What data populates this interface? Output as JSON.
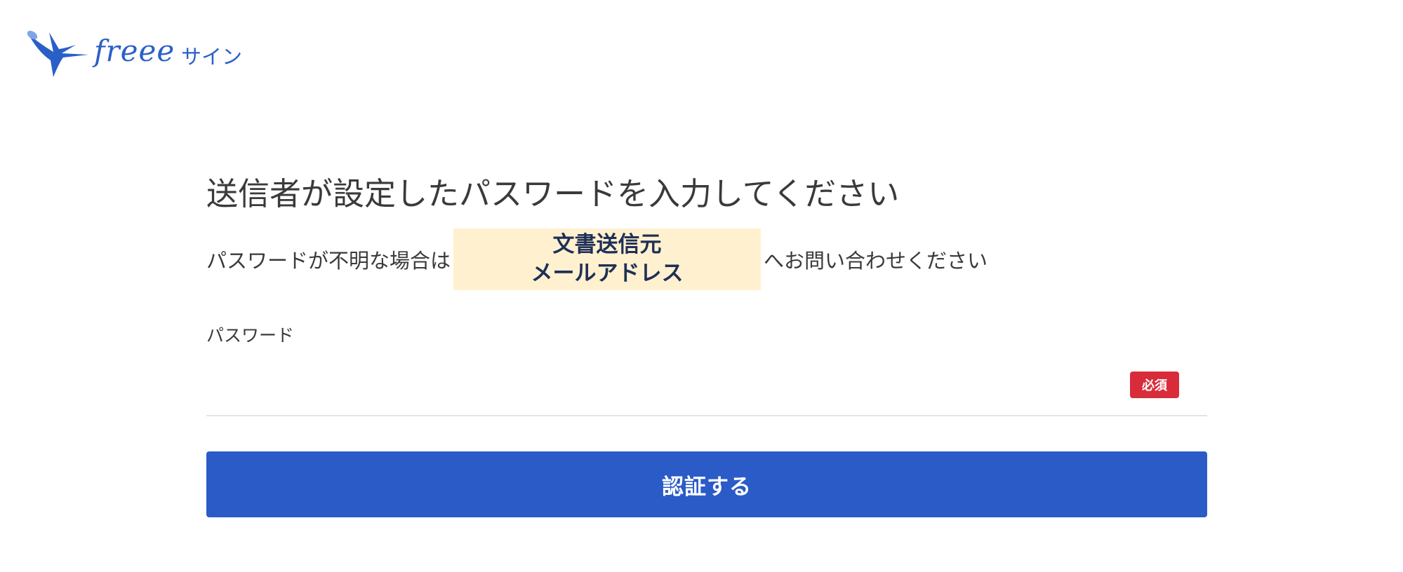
{
  "brand": {
    "logo_text": "freee",
    "logo_sub": "サイン",
    "color": "#2b5fc8"
  },
  "page": {
    "title": "送信者が設定したパスワードを入力してください",
    "notice_prefix": "パスワードが不明な場合は",
    "notice_highlight_line1": "文書送信元",
    "notice_highlight_line2": "メールアドレス",
    "notice_suffix": "へお問い合わせください"
  },
  "form": {
    "password_label": "パスワード",
    "password_value": "",
    "required_badge": "必須",
    "submit_label": "認証する"
  },
  "colors": {
    "button": "#2a5bc7",
    "required": "#d92c3a",
    "highlight": "#fff1cf"
  }
}
